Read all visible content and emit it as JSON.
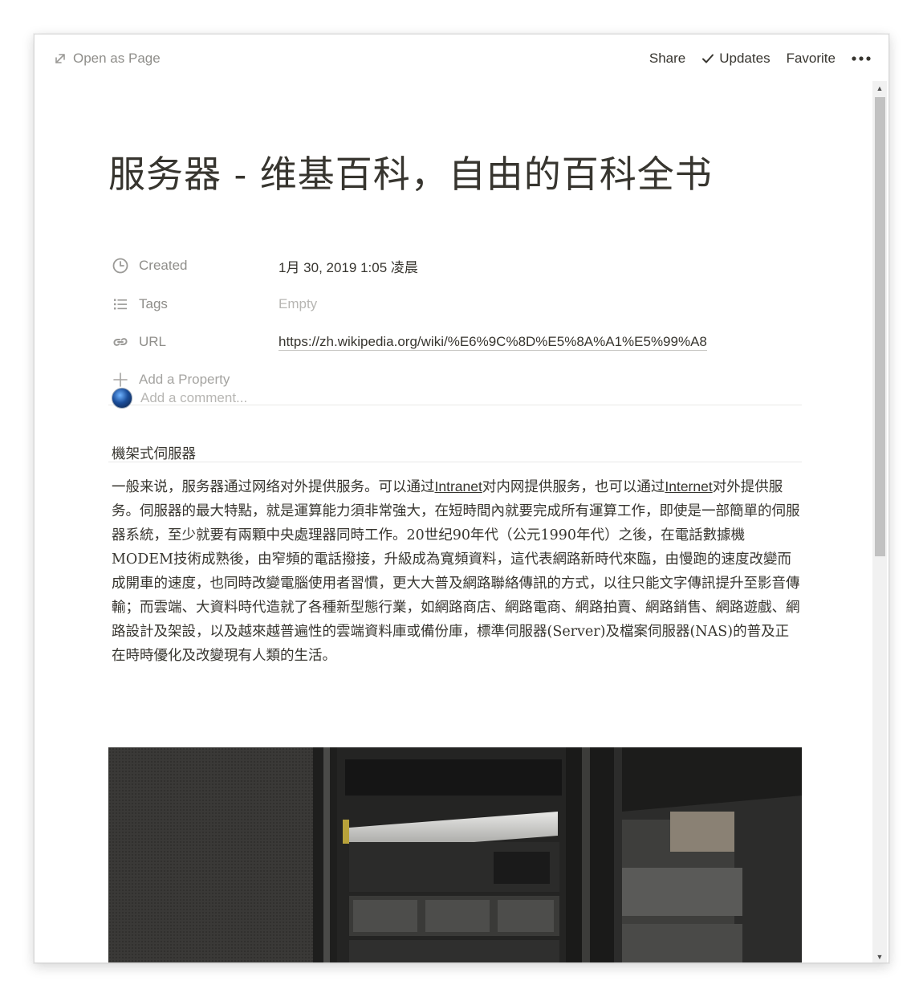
{
  "topbar": {
    "open_as_page": "Open as Page",
    "share": "Share",
    "updates": "Updates",
    "favorite": "Favorite",
    "more_icon": "ellipsis-icon"
  },
  "page": {
    "title": "服务器 - 维基百科，自由的百科全书"
  },
  "properties": [
    {
      "key": "Created",
      "icon": "clock-icon",
      "value": "1月 30, 2019 1:05 凌晨"
    },
    {
      "key": "Tags",
      "icon": "list-icon",
      "value": "Empty"
    },
    {
      "key": "URL",
      "icon": "link-icon",
      "value": "https://zh.wikipedia.org/wiki/%E6%9C%8D%E5%8A%A1%E5%99%A8"
    }
  ],
  "add_property": "Add a Property",
  "comment": {
    "placeholder": "Add a comment..."
  },
  "body": {
    "caption": "機架式伺服器",
    "p_part1": "一般来说，服务器通过网络对外提供服务。可以通过",
    "link_intranet": "Intranet",
    "p_part2": "对内网提供服务，也可以通过",
    "link_internet": "Internet",
    "p_part3": "对外提供服务。伺服器的最大特點，就是運算能力須非常強大，在短時間內就要完成所有運算工作，即使是一部簡單的伺服器系統，至少就要有兩顆中央處理器同時工作。20世纪90年代（公元1990年代）之後，在電話數據機MODEM技術成熟後，由窄頻的電話撥接，升級成為寬頻資料，這代表網路新時代來臨，由慢跑的速度改變而成開車的速度，也同時改變電腦使用者習慣，更大大普及網路聯絡傳訊的方式，以往只能文字傳訊提升至影音傳輸；而雲端、大資料時代造就了各種新型態行業，如網路商店、網路電商、網路拍賣、網路銷售、網路遊戲、網路設計及架設，以及越來越普遍性的雲端資料庫或備份庫，標準伺服器(Server)及檔案伺服器(NAS)的普及正在時時優化及改變現有人類的生活。"
  }
}
